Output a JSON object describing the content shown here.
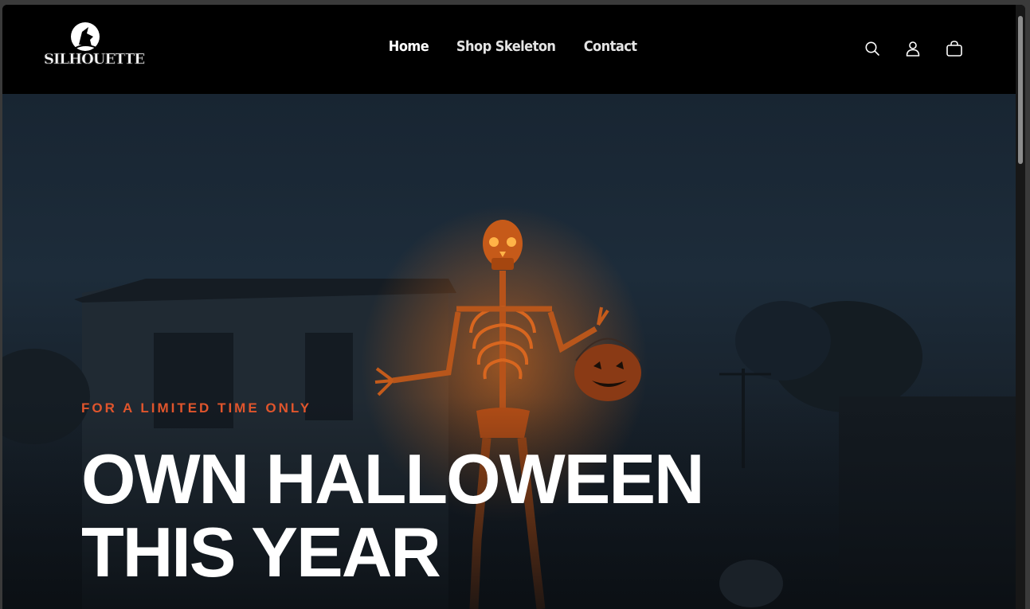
{
  "brand": {
    "name": "SILHOUETTE"
  },
  "nav": {
    "items": [
      {
        "label": "Home"
      },
      {
        "label": "Shop Skeleton"
      },
      {
        "label": "Contact"
      }
    ]
  },
  "header_icons": [
    "search-icon",
    "account-icon",
    "cart-icon"
  ],
  "hero": {
    "eyebrow": "FOR A LIMITED TIME ONLY",
    "headline_line1": "OWN HALLOWEEN",
    "headline_line2": "THIS YEAR"
  },
  "colors": {
    "accent": "#e0552c",
    "header_bg": "#000000",
    "text": "#ffffff"
  }
}
